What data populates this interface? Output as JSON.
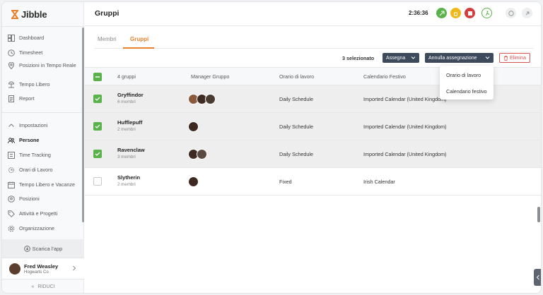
{
  "app": {
    "logo": "Jibble",
    "page_title": "Gruppi"
  },
  "header": {
    "timer": "2:36:36"
  },
  "sidebar": {
    "items": [
      {
        "label": "Dashboard",
        "icon": "dashboard-icon"
      },
      {
        "label": "Timesheet",
        "icon": "clock-icon"
      },
      {
        "label": "Posizioni in Tempo Reale",
        "icon": "location-pin-icon"
      },
      {
        "label": "Tempo Libero",
        "icon": "beach-icon"
      },
      {
        "label": "Report",
        "icon": "report-icon"
      }
    ],
    "settings_label": "Impostazioni",
    "settings_items": [
      {
        "label": "Persone",
        "icon": "people-icon",
        "active": true
      },
      {
        "label": "Time Tracking",
        "icon": "time-tracking-icon"
      },
      {
        "label": "Orari di Lavoro",
        "icon": "work-hours-icon"
      },
      {
        "label": "Tempo Libero e Vacanze",
        "icon": "calendar-icon"
      },
      {
        "label": "Posizioni",
        "icon": "location-pin-icon"
      },
      {
        "label": "Attività e Progetti",
        "icon": "tag-icon"
      },
      {
        "label": "Organizzazione",
        "icon": "gear-icon"
      }
    ],
    "download_app": "Scarica l'app",
    "user": {
      "name": "Fred Weasley",
      "company": "Hogwarts Co"
    },
    "collapse": "RIDUCI"
  },
  "tabs": [
    {
      "label": "Membri"
    },
    {
      "label": "Gruppi",
      "active": true
    }
  ],
  "toolbar": {
    "selected": "3 selezionato",
    "assign": "Assegna",
    "unassign": "Annulla assegnazione",
    "delete": "Elimina"
  },
  "table": {
    "headers": {
      "count": "4 gruppi",
      "manager": "Manager Gruppo",
      "schedule": "Orario di lavoro",
      "holiday": "Calendario Festivo"
    },
    "rows": [
      {
        "name": "Gryffindor",
        "members": "6 membri",
        "schedule": "Daily Schedule",
        "calendar": "Imported Calendar (United Kingdom)",
        "selected": true,
        "managers": 3
      },
      {
        "name": "Hufflepuff",
        "members": "2 membri",
        "schedule": "Daily Schedule",
        "calendar": "Imported Calendar (United Kingdom)",
        "selected": true,
        "managers": 1
      },
      {
        "name": "Ravenclaw",
        "members": "3 membri",
        "schedule": "Daily Schedule",
        "calendar": "Imported Calendar (United Kingdom)",
        "selected": true,
        "managers": 2
      },
      {
        "name": "Slytherin",
        "members": "2 membri",
        "schedule": "Fixed",
        "calendar": "Irish Calendar",
        "selected": false,
        "managers": 1
      }
    ]
  },
  "dropdown": {
    "items": [
      "Orario di lavoro",
      "Calendario festivo"
    ]
  },
  "colors": {
    "accent": "#e8822c",
    "check": "#5ab24a",
    "primary_dark": "#3d4a5c",
    "danger": "#d9534f"
  }
}
